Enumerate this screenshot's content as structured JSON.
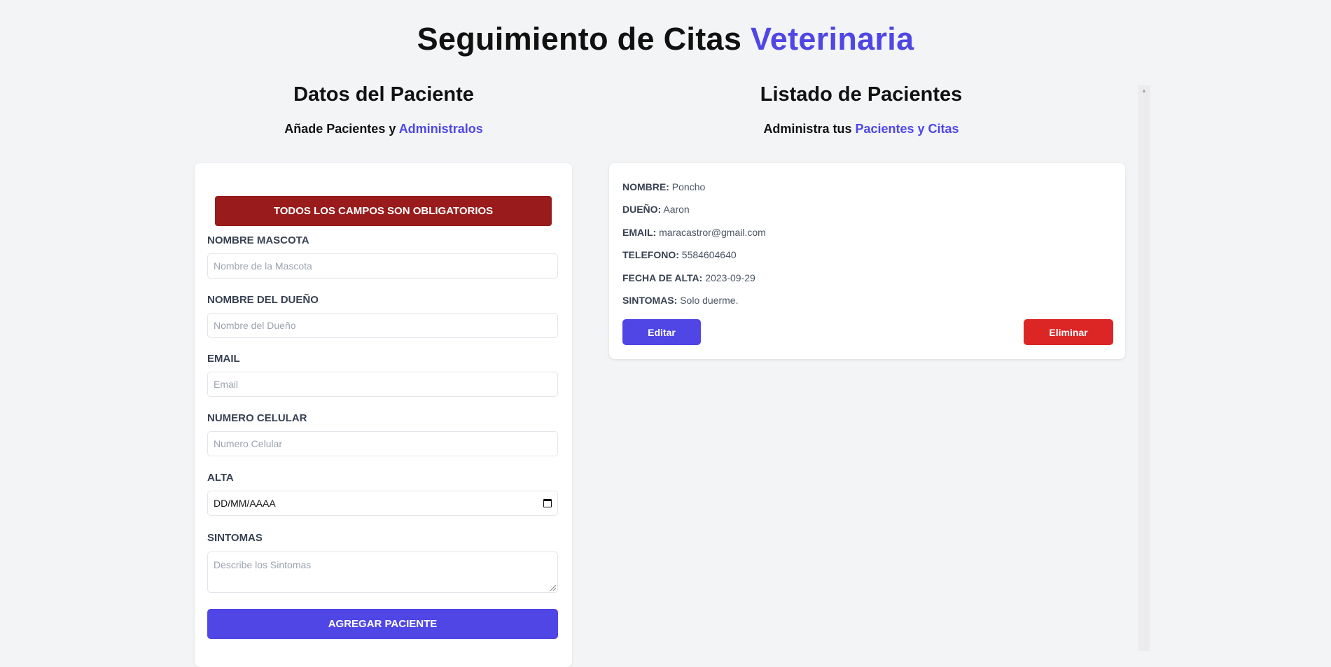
{
  "header": {
    "title_main": "Seguimiento de Citas",
    "title_accent": "Veterinaria"
  },
  "form_section": {
    "heading": "Datos del Paciente",
    "subtitle_main": "Añade Pacientes y",
    "subtitle_accent": "Administralos"
  },
  "list_section": {
    "heading": "Listado de Pacientes",
    "subtitle_main": "Administra tus",
    "subtitle_accent": "Pacientes y Citas"
  },
  "form": {
    "error_message": "TODOS LOS CAMPOS SON OBLIGATORIOS",
    "fields": [
      {
        "label": "Nombre Mascota",
        "placeholder": "Nombre de la Mascota",
        "value": ""
      },
      {
        "label": "Nombre del Dueño",
        "placeholder": "Nombre del Dueño",
        "value": ""
      },
      {
        "label": "Email",
        "placeholder": "Email",
        "value": ""
      },
      {
        "label": "Numero Celular",
        "placeholder": "Numero Celular",
        "value": ""
      },
      {
        "label": "Alta",
        "placeholder": "DD/MM/AAAA",
        "value": ""
      },
      {
        "label": "Sintomas",
        "placeholder": "Describe los Sintomas",
        "value": ""
      }
    ],
    "submit_label": "AGREGAR PACIENTE"
  },
  "patients": [
    {
      "rows": [
        {
          "label": "Nombre:",
          "value": "Poncho"
        },
        {
          "label": "Dueño:",
          "value": "Aaron"
        },
        {
          "label": "Email:",
          "value": "maracastror@gmail.com"
        },
        {
          "label": "Telefono:",
          "value": "5584604640"
        },
        {
          "label": "Fecha de alta:",
          "value": "2023-09-29"
        },
        {
          "label": "Sintomas:",
          "value": "Solo duerme."
        }
      ],
      "edit_label": "Editar",
      "delete_label": "Eliminar"
    }
  ],
  "colors": {
    "accent": "#4f46e5",
    "error": "#991b1b",
    "danger": "#dc2626",
    "background": "#f3f4f6"
  },
  "icons": {
    "date_picker": "calendar-icon",
    "textarea_resize": "resize-handle-icon",
    "scroll_up": "scroll-up-arrow-icon"
  }
}
